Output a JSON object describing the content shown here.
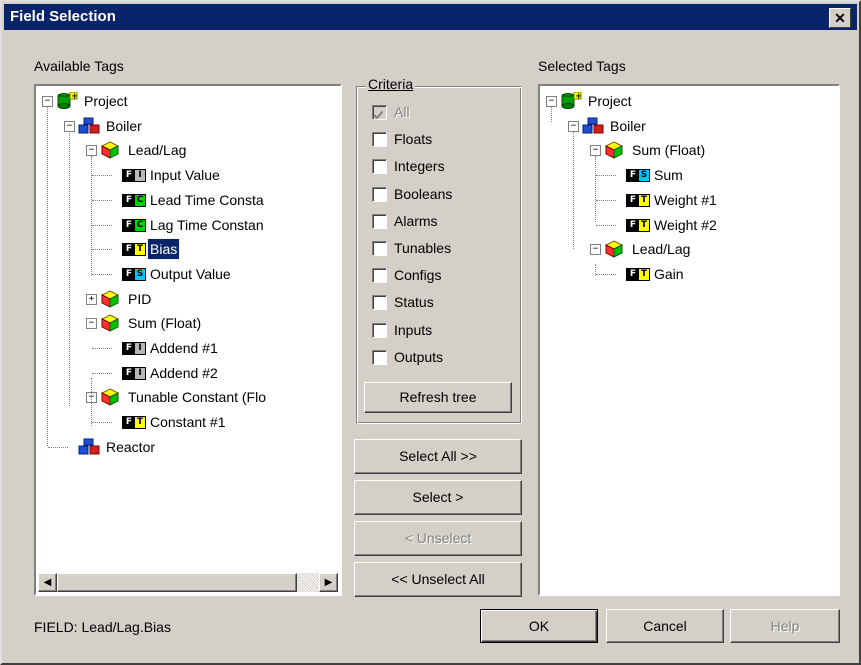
{
  "window": {
    "title": "Field Selection",
    "close_symbol": "✕"
  },
  "available": {
    "label": "Available Tags",
    "nodes": [
      {
        "text": "Project"
      },
      {
        "text": "Boiler"
      },
      {
        "text": "Lead/Lag"
      },
      {
        "text": "Input Value",
        "tag": [
          "F",
          "I"
        ]
      },
      {
        "text": "Lead Time Consta",
        "tag": [
          "F",
          "C"
        ]
      },
      {
        "text": "Lag Time Constan",
        "tag": [
          "F",
          "C"
        ]
      },
      {
        "text": "Bias",
        "tag": [
          "F",
          "T"
        ]
      },
      {
        "text": "Output Value",
        "tag": [
          "F",
          "S"
        ]
      },
      {
        "text": "PID"
      },
      {
        "text": "Sum (Float)"
      },
      {
        "text": "Addend #1",
        "tag": [
          "F",
          "I"
        ]
      },
      {
        "text": "Addend #2",
        "tag": [
          "F",
          "I"
        ]
      },
      {
        "text": "Tunable Constant (Flo"
      },
      {
        "text": "Constant #1",
        "tag": [
          "F",
          "T"
        ]
      },
      {
        "text": "Reactor"
      }
    ]
  },
  "criteria": {
    "label": "Criteria",
    "items": [
      {
        "label": "All",
        "checked": true,
        "disabled": true
      },
      {
        "label": "Floats",
        "checked": false
      },
      {
        "label": "Integers",
        "checked": false
      },
      {
        "label": "Booleans",
        "checked": false
      },
      {
        "label": "Alarms",
        "checked": false
      },
      {
        "label": "Tunables",
        "checked": false
      },
      {
        "label": "Configs",
        "checked": false
      },
      {
        "label": "Status",
        "checked": false
      },
      {
        "label": "Inputs",
        "checked": false
      },
      {
        "label": "Outputs",
        "checked": false
      }
    ],
    "refresh_label": "Refresh tree"
  },
  "buttons": {
    "select_all": "Select All >>",
    "select": "Select >",
    "unselect": "< Unselect",
    "unselect_all": "<< Unselect All",
    "ok": "OK",
    "cancel": "Cancel",
    "help": "Help"
  },
  "selected": {
    "label": "Selected Tags",
    "nodes": [
      {
        "text": "Project"
      },
      {
        "text": "Boiler"
      },
      {
        "text": "Sum (Float)"
      },
      {
        "text": "Sum",
        "tag": [
          "F",
          "S"
        ]
      },
      {
        "text": "Weight #1",
        "tag": [
          "F",
          "T"
        ]
      },
      {
        "text": "Weight #2",
        "tag": [
          "F",
          "T"
        ]
      },
      {
        "text": "Lead/Lag"
      },
      {
        "text": "Gain",
        "tag": [
          "F",
          "T"
        ]
      }
    ]
  },
  "status": {
    "field_text": "FIELD: Lead/Lag.Bias"
  },
  "colors": {
    "titlebar": "#0a246a",
    "face": "#d4d0c8",
    "selection": "#0a246a",
    "tag_I": "#b8b8b8",
    "tag_C": "#00d000",
    "tag_T": "#ffff00",
    "tag_S": "#00c8ff"
  }
}
